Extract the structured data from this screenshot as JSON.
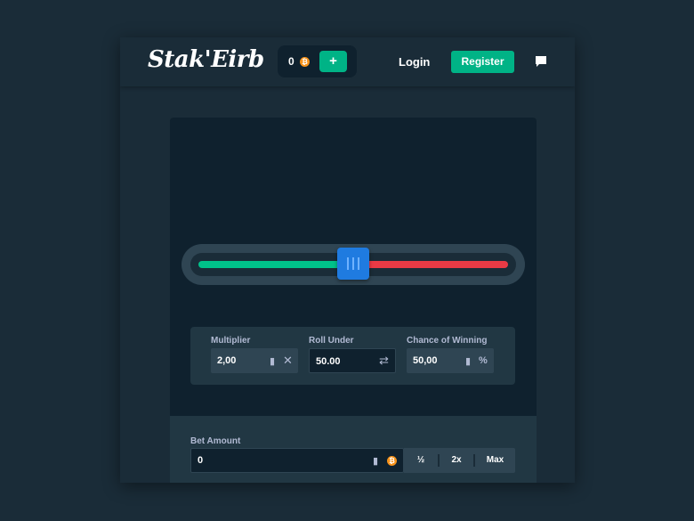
{
  "header": {
    "logo": "Stak'Eirb",
    "wallet_balance": "0",
    "wallet_add_label": "+",
    "login_label": "Login",
    "register_label": "Register",
    "chat_icon": "chat-bubble-icon"
  },
  "game": {
    "slider": {
      "value_fraction": 0.5,
      "below_color": "#00c28a",
      "above_color": "#e83a45",
      "handle_color": "#1f7be0"
    },
    "stats": {
      "multiplier_label": "Multiplier",
      "multiplier_value": "2,00",
      "roll_under_label": "Roll Under",
      "roll_under_value": "50.00",
      "chance_label": "Chance of Winning",
      "chance_value": "50,00"
    }
  },
  "bet": {
    "label": "Bet Amount",
    "value": "0",
    "half_label": "½",
    "double_label": "2x",
    "max_label": "Max"
  },
  "colors": {
    "background": "#1a2c38",
    "panel": "#0f212e",
    "accent_green": "#00b386",
    "coin": "#f7931a"
  }
}
